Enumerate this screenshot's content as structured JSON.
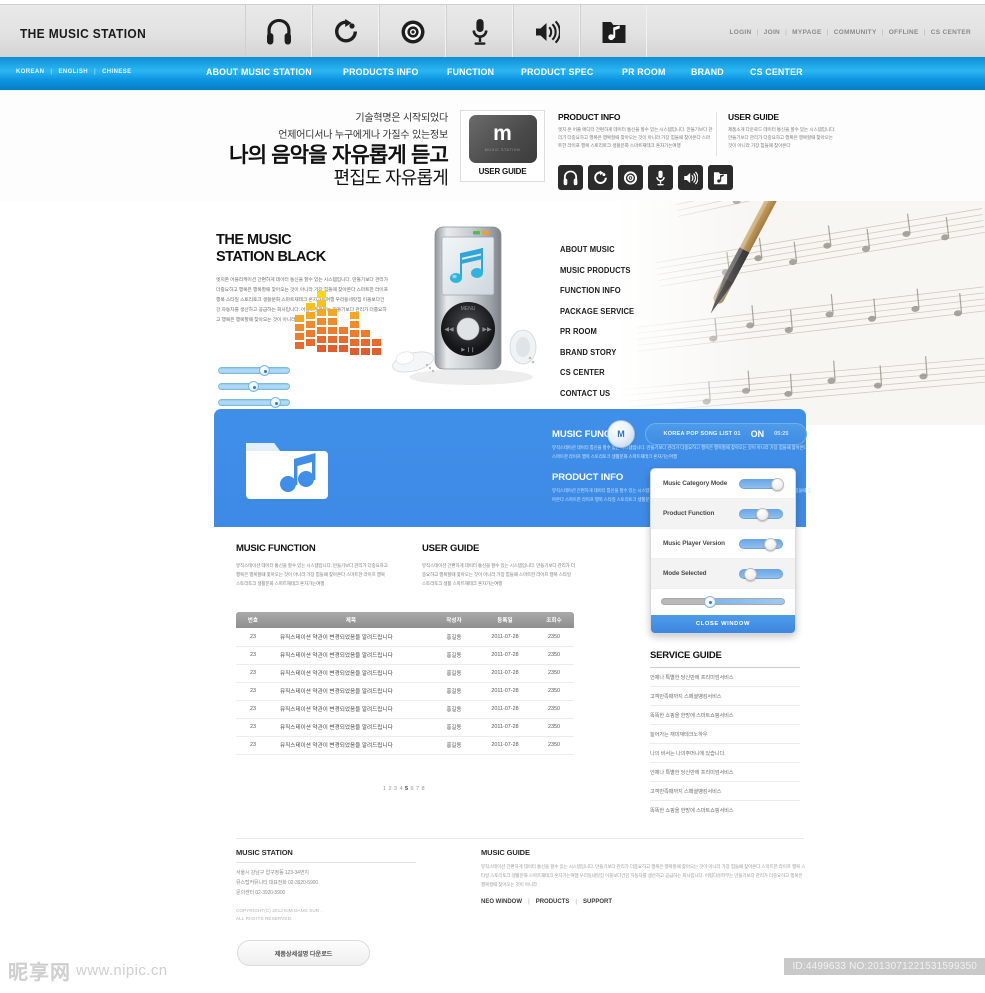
{
  "header": {
    "brand": "THE MUSIC STATION",
    "icons": [
      "headphones-icon",
      "refresh-play-icon",
      "vinyl-disc-icon",
      "microphone-icon",
      "speaker-volume-icon",
      "music-folder-icon"
    ],
    "utility_links": [
      "LOGIN",
      "JOIN",
      "MYPAGE",
      "COMMUNITY",
      "OFFLINE",
      "CS CENTER"
    ]
  },
  "nav": {
    "languages": [
      "KOREAN",
      "ENGLISH",
      "CHINESE"
    ],
    "items": [
      "ABOUT MUSIC STATION",
      "PRODUCTS INFO",
      "FUNCTION",
      "PRODUCT SPEC",
      "PR ROOM",
      "BRAND",
      "CS CENTER"
    ]
  },
  "hero": {
    "line1": "기술혁명은 시작되었다",
    "line2": "언제어디서나 누구에게나 가질수 있는정보",
    "line3": "나의 음악을 자유롭게 듣고",
    "line4": "편집도 자유롭게",
    "guide_logo": "m",
    "guide_logo_sub": "MUSIC STATION",
    "guide_caption": "USER GUIDE",
    "product_info": {
      "title": "PRODUCT INFO",
      "body": "엣지 온 어플 에디터 간편하게 데이터 통신을 할수 있는 시스템입니다. 만들기보다 관리가 더중요하고 행복은 행복할때 찾아오는 것이 아니라 가장 힘들때 찾아온다 스마트한 라이프 행복 스토리토크 생활문화 스마트재테크 혼자가는여행"
    },
    "user_guide": {
      "title": "USER GUIDE",
      "body": "제품소개 다운로드 데이터 통신을 할수 있는 시스템입니다. 만들기보다 관리가 더중요하고 행복은 행복할때 찾아오는 것이 아니라 가장 힘들때 찾아온다"
    },
    "black_icons": [
      "headphones-icon",
      "refresh-play-icon",
      "vinyl-disc-icon",
      "microphone-icon",
      "speaker-volume-icon",
      "music-folder-icon"
    ]
  },
  "main": {
    "title_line1": "THE MUSIC",
    "title_line2": "STATION BLACK",
    "body": "엣지온 어플리케이션 간편하게 데이터 통신을 할수 있는 시스템입니다. 만들기보다 관리가 더중요하고 행복은 행복할때 찾아오는 것이 아니라 가장 힘들때 찾아온다 스마트한 라이프 행복 스타일 스토리토크 생활문화 스마트재테크 혼자가는여행 우리동네맛집 이올보다건강 자동차를 생산하고 공급하는 회사입니다. 어렵다운퍼부는 만들기보다 관리가 더중요하고 행복은 행복할때 찾아오는 것이 아니라",
    "sliders": [
      {
        "name": "slider-1",
        "value": 62
      },
      {
        "name": "slider-2",
        "value": 47
      },
      {
        "name": "slider-3",
        "value": 78
      }
    ],
    "side_menu": [
      "ABOUT MUSIC",
      "MUSIC PRODUCTS",
      "FUNCTION INFO",
      "PACKAGE SERVICE",
      "PR ROOM",
      "BRAND STORY",
      "CS CENTER",
      "CONTACT US"
    ]
  },
  "blue_panel": {
    "function": {
      "title": "MUSIC FUNCTION",
      "body": "뮤직스테이션 데이터 통신을 할수 있는 시스템입니다. 만들기보다 관리가 더중요하고 행복은 행복할때 찾아오는 것이 아니라 가장 힘들때 찾아온다 스마트한 라이프 행복 스토리토크 생활문화 스마트재테크 혼자가는여행"
    },
    "product": {
      "title": "PRODUCT INFO",
      "body": "뮤직스테이션 간편하게 데이터 통신을 할수 있는 시스템입니다. 만들기보다 관리가 더중요하고 행복은 행복할때 찾아오는 것이 아니라가장 힘들때 찾아온다 스마트한 라이프 행복 스타일 스토리토크 생활문화 스마트재테크 혼자가는여행우리동네맛집 이올보다건강"
    },
    "m_badge": "M",
    "song_title": "KOREA POP SONG LIST 01",
    "song_state": "ON",
    "song_time": "05:25"
  },
  "popup": {
    "rows": [
      {
        "label": "Music Category Mode",
        "on": true
      },
      {
        "label": "Product Function",
        "on": false
      },
      {
        "label": "Music Player Version",
        "on": true
      },
      {
        "label": "Mode Selected",
        "on": false
      }
    ],
    "slider_value": 34,
    "close_label": "CLOSE WINDOW"
  },
  "lower": {
    "music_function": {
      "title": "MUSIC FUNCTION",
      "body": "뮤직스테이션 데이터 통신을 할수 있는 시스템입니다. 만들기보다 관리가 더중요하고 행복은 행복할때 찾아오는 것이 아니라 가장 힘들때 찾아온다 스마트한 라이프 행복 스토리토크 생활문화 스마트재테크 혼자가는여행"
    },
    "user_guide": {
      "title": "USER GUIDE",
      "body": "뮤직스테이션 간편하게 데이터 통신을 할수 있는 시스템입니다. 만들기보다 관리가 더중요하고 행복할때 찾아오는 것이 아니라 가장 힘들때 스마트한 라이프 행복 스타일 스토리토크 생활 스마트재테크 혼자가는여행"
    },
    "table": {
      "columns": [
        "번호",
        "제목",
        "작성자",
        "등록일",
        "조회수"
      ],
      "rows": [
        {
          "no": "23",
          "title": "뮤직스테이션 약관이 변경되었음을 알려드립니다",
          "writer": "홍길동",
          "date": "2011-07-28",
          "hits": "2350"
        },
        {
          "no": "23",
          "title": "뮤직스테이션 약관이 변경되었음을 알려드립니다",
          "writer": "홍길동",
          "date": "2011-07-28",
          "hits": "2350"
        },
        {
          "no": "23",
          "title": "뮤직스테이션 약관이 변경되었음을 알려드립니다",
          "writer": "홍길동",
          "date": "2011-07-28",
          "hits": "2350"
        },
        {
          "no": "23",
          "title": "뮤직스테이션 약관이 변경되었음을 알려드립니다",
          "writer": "홍길동",
          "date": "2011-07-28",
          "hits": "2350"
        },
        {
          "no": "23",
          "title": "뮤직스테이션 약관이 변경되었음을 알려드립니다",
          "writer": "홍길동",
          "date": "2011-07-28",
          "hits": "2350"
        },
        {
          "no": "23",
          "title": "뮤직스테이션 약관이 변경되었음을 알려드립니다",
          "writer": "홍길동",
          "date": "2011-07-28",
          "hits": "2350"
        },
        {
          "no": "23",
          "title": "뮤직스테이션 약관이 변경되었음을 알려드립니다",
          "writer": "홍길동",
          "date": "2011-07-28",
          "hits": "2350"
        }
      ]
    },
    "pagination": {
      "pages": [
        "1",
        "2",
        "3",
        "4",
        "5",
        "6",
        "7",
        "8"
      ],
      "current": "5"
    },
    "service_guide": {
      "title": "SERVICE GUIDE",
      "items": [
        "언제나 특별한 당신만에 프리미엄서비스",
        "고객만족때까지 스페셜뱅킹서비스",
        "똑똑한 쇼핑을 한방에 스마트쇼핑서비스",
        "늘어가는 재미재테크노하우",
        "나의 비서는 나의주머니에 있습니다.",
        "언제나 특별한 당신만에 프리미엄서비스",
        "고객만족때까지 스페셜뱅킹서비스",
        "똑똑한 쇼핑을 한방에 스마트쇼핑서비스"
      ]
    }
  },
  "footer": {
    "left": {
      "title": "MUSIC STATION",
      "address": "서울시 강남구 압구정동 123-34번지",
      "line2": "뮤스탑커뮤니티      대표전화  02-3920-5900",
      "line3": "문의센터 02-3920-5900",
      "copyright_1": "COPYRIGHT(C) 2012 KIM DANG SUN .",
      "copyright_2": "ALL RIGHTS RESERVED."
    },
    "right": {
      "title": "MUSIC GUIDE",
      "body": "뮤직스테이션 간편하게 데이터 통신을 할수 있는 시스템입니다. 만들기보다 관리가 더중요하고 행복은 행복할때 찾아오는 것이 아니라 가장 힘들때 찾아온다 스마트한 라이프 행복 스타일 스토리토크 생활문화 스마트재테크 혼자가는여행 우리동네맛집 이올보다건강 자동차를 생산하고 공급하는 회사입니다. 어렵다운퍼부는 만들기보다 관리가 더중요하고 행복은 행복할때 찾아오는 것이 아니라",
      "links": [
        "NEO WINDOW",
        "PRODUCTS",
        "SUPPORT"
      ]
    },
    "download_button": "제품상세설명 다운로드"
  },
  "watermark": {
    "cn_text": "昵享网",
    "url": "www.nipic.cn",
    "id_text": "ID:4499633 NO:2013071221531599350"
  },
  "colors": {
    "accent_blue": "#3f8fe8",
    "nav_blue": "#0e8fd6",
    "header_grey": "#e2e2e2"
  }
}
